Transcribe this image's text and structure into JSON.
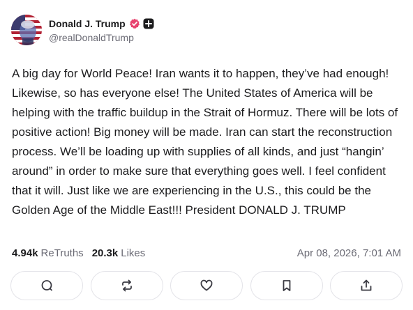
{
  "post": {
    "author": {
      "display_name": "Donald J. Trump",
      "handle": "@realDonaldTrump",
      "avatar_icon": "avatar-flag-portrait",
      "verified_icon": "verified-badge-icon",
      "verified_color": "#e8446f",
      "extra_badge_icon": "plus-badge-icon"
    },
    "text": "A big day for World Peace! Iran wants it to happen, they’ve had enough! Likewise, so has everyone else! The United States of America will be helping with the traffic buildup in the Strait of Hormuz. There will be lots of positive action! Big money will be made. Iran can start the reconstruction process. We’ll be loading up with supplies of all kinds, and just “hangin’ around” in order to make sure that everything goes well. I feel confident that it will. Just like we are experiencing in the U.S., this could be the Golden Age of the Middle East!!! President DONALD J. TRUMP",
    "stats": {
      "retruths_count": "4.94k",
      "retruths_label": "ReTruths",
      "likes_count": "20.3k",
      "likes_label": "Likes"
    },
    "timestamp": "Apr 08, 2026, 7:01 AM",
    "actions": [
      {
        "icon": "comment-icon"
      },
      {
        "icon": "retruth-icon"
      },
      {
        "icon": "heart-icon"
      },
      {
        "icon": "bookmark-icon"
      },
      {
        "icon": "share-icon"
      }
    ]
  }
}
